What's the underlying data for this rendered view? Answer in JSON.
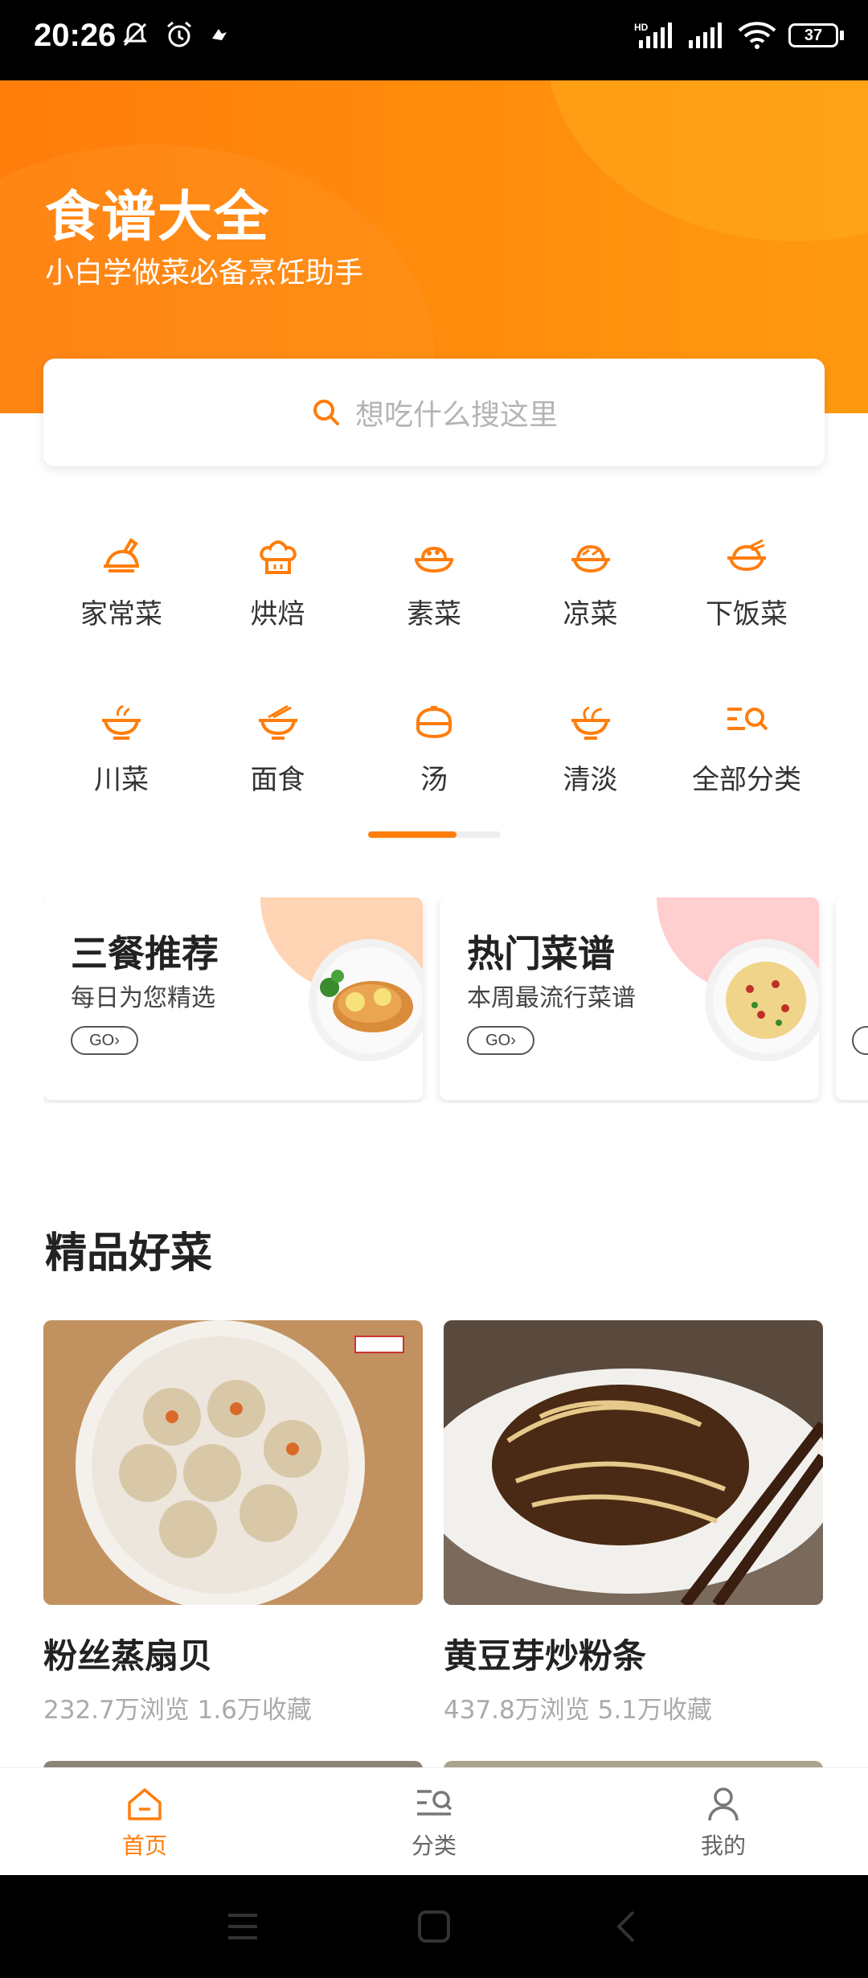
{
  "status_bar": {
    "time": "20:26",
    "battery": "37",
    "icons": [
      "mute-icon",
      "alarm-icon",
      "app-notification-icon",
      "hd-signal-icon",
      "signal-icon",
      "wifi-icon",
      "battery-icon"
    ]
  },
  "header": {
    "title": "食谱大全",
    "subtitle": "小白学做菜必备烹饪助手"
  },
  "search": {
    "placeholder": "想吃什么搜这里"
  },
  "categories": [
    {
      "label": "家常菜",
      "icon": "home-dish-icon"
    },
    {
      "label": "烘焙",
      "icon": "baking-icon"
    },
    {
      "label": "素菜",
      "icon": "vegetable-dish-icon"
    },
    {
      "label": "凉菜",
      "icon": "cold-dish-icon"
    },
    {
      "label": "下饭菜",
      "icon": "rice-dish-icon"
    },
    {
      "label": "川菜",
      "icon": "sichuan-dish-icon"
    },
    {
      "label": "面食",
      "icon": "noodles-icon"
    },
    {
      "label": "汤",
      "icon": "soup-icon"
    },
    {
      "label": "清淡",
      "icon": "light-dish-icon"
    },
    {
      "label": "全部分类",
      "icon": "all-categories-icon"
    }
  ],
  "feature_cards": [
    {
      "title": "三餐推荐",
      "subtitle": "每日为您精选",
      "button": "GO›",
      "accent": "#ffd4b5"
    },
    {
      "title": "热门菜谱",
      "subtitle": "本周最流行菜谱",
      "button": "GO›",
      "accent": "#ffcfd0"
    }
  ],
  "section": {
    "title": "精品好菜"
  },
  "recipes": [
    {
      "name": "粉丝蒸扇贝",
      "stats": "232.7万浏览 1.6万收藏"
    },
    {
      "name": "黄豆芽炒粉条",
      "stats": "437.8万浏览 5.1万收藏"
    }
  ],
  "tabs": [
    {
      "label": "首页",
      "icon": "home-icon",
      "active": true
    },
    {
      "label": "分类",
      "icon": "category-icon",
      "active": false
    },
    {
      "label": "我的",
      "icon": "profile-icon",
      "active": false
    }
  ],
  "colors": {
    "accent": "#ff7d0b",
    "header_gradient_end": "#ff9a10"
  }
}
